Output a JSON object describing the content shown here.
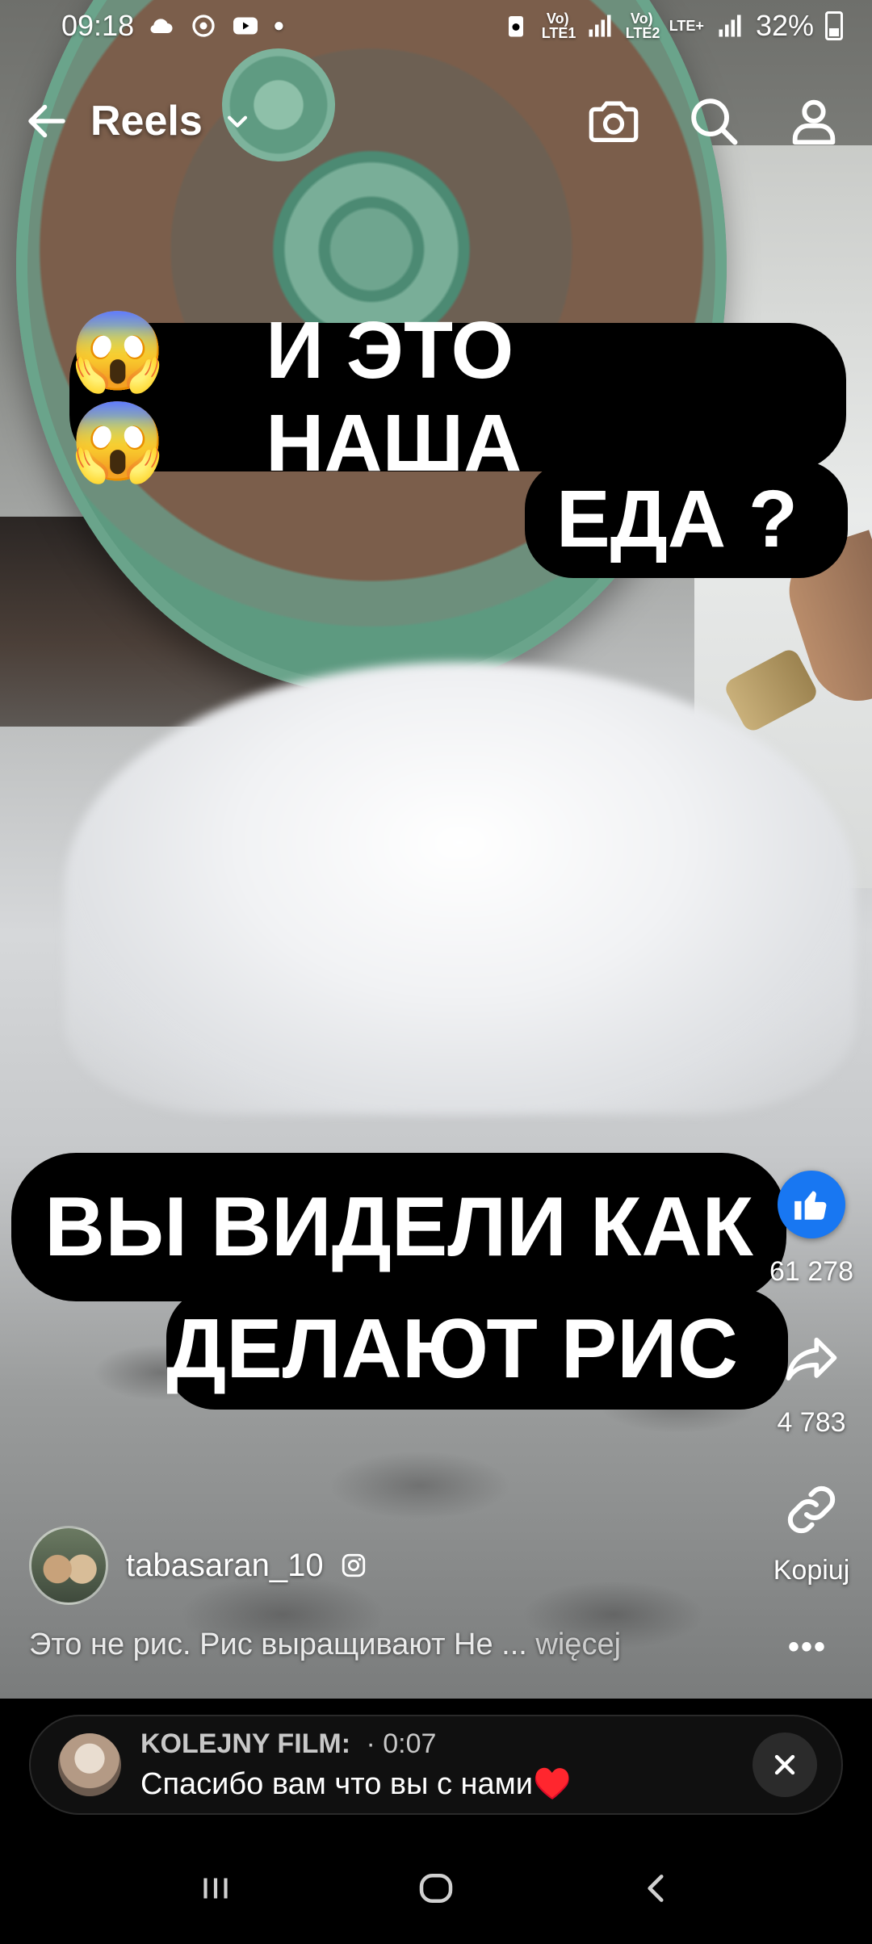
{
  "status_bar": {
    "time": "09:18",
    "sim1_label": "Vo) LTE1",
    "sim2_label": "Vo) LTE2",
    "network_type": "LTE+",
    "battery": "32%"
  },
  "top_bar": {
    "title": "Reels"
  },
  "captions": {
    "top_line1": "И ЭТО НАША",
    "top_emoji": "😱😱",
    "top_line2": "ЕДА ?",
    "bottom_line1": "ВЫ ВИДЕЛИ КАК",
    "bottom_line2": "ДЕЛАЮТ РИС"
  },
  "actions": {
    "likes": "61 278",
    "shares": "4 783",
    "copy_label": "Kopiuj"
  },
  "post": {
    "author": "tabasaran_10",
    "description": "Это не рис.  Рис выращивают Не ...",
    "more_label": "więcej",
    "more_dots": "•••"
  },
  "next_film": {
    "label": "KOLEJNY FILM:",
    "time": "· 0:07",
    "title": "Спасибо вам что вы с нами♥️"
  },
  "colors": {
    "like_blue": "#1877f2",
    "caption_bg": "#000000"
  }
}
